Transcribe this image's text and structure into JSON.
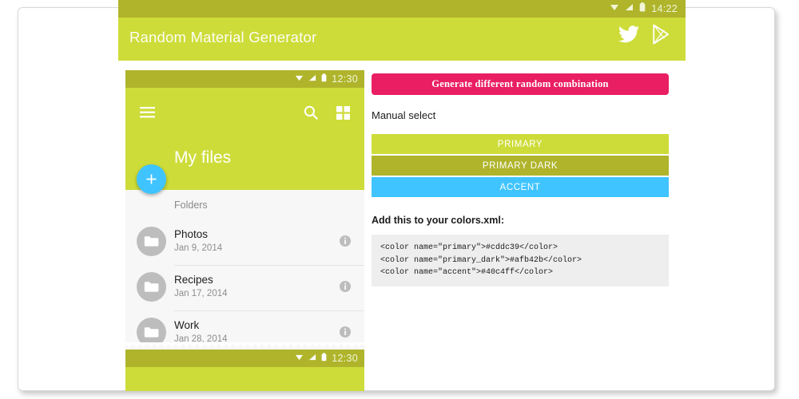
{
  "header": {
    "title": "Random Material Generator",
    "status": {
      "time": "14:22",
      "icons": [
        "wifi-icon",
        "signal-icon",
        "battery-icon"
      ]
    },
    "actions": [
      {
        "name": "twitter-icon",
        "label": "Twitter"
      },
      {
        "name": "google-play-icon",
        "label": "Google Play"
      }
    ]
  },
  "phone": {
    "status": {
      "time": "12:30",
      "icons": [
        "wifi-icon",
        "signal-icon",
        "battery-icon"
      ]
    },
    "status_bottom": {
      "time": "12:30"
    },
    "appbar": {
      "menu_icon": "hamburger-menu-icon",
      "search_icon": "search-icon",
      "grid_icon": "grid-view-icon",
      "title": "My files"
    },
    "fab": {
      "label": "+",
      "name": "add-fab"
    },
    "subheader": "Folders",
    "files": [
      {
        "name": "Photos",
        "date": "Jan 9, 2014"
      },
      {
        "name": "Recipes",
        "date": "Jan 17, 2014"
      },
      {
        "name": "Work",
        "date": "Jan 28, 2014"
      }
    ]
  },
  "panel": {
    "generate_button": "Generate different random combination",
    "manual_select_label": "Manual select",
    "swatches": [
      {
        "label": "PRIMARY",
        "color": "#cddc39"
      },
      {
        "label": "PRIMARY DARK",
        "color": "#afb42b"
      },
      {
        "label": "ACCENT",
        "color": "#40c4ff"
      }
    ],
    "xml_label": "Add this to your colors.xml:",
    "xml_code": "<color name=\"primary\">#cddc39</color>\n<color name=\"primary_dark\">#afb42b</color>\n<color name=\"accent\">#40c4ff</color>"
  },
  "colors": {
    "primary": "#cddc39",
    "primary_dark": "#afb42b",
    "accent": "#40c4ff",
    "generate": "#e91e63"
  }
}
